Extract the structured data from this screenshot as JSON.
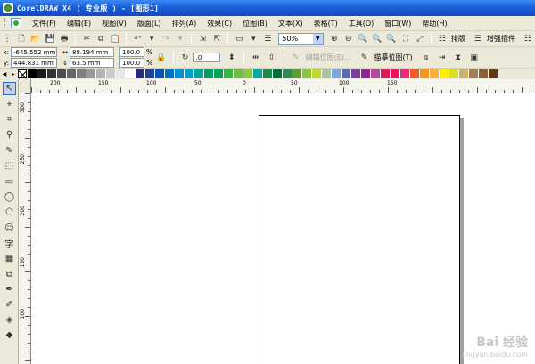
{
  "window": {
    "title": "CorelDRAW X4 ( 专业版 ) - [图形1]"
  },
  "menu": {
    "items": [
      "文件(F)",
      "编辑(E)",
      "视图(V)",
      "版面(L)",
      "排列(A)",
      "效果(C)",
      "位图(B)",
      "文本(X)",
      "表格(T)",
      "工具(O)",
      "窗口(W)",
      "帮助(H)"
    ]
  },
  "toolbar": {
    "zoom_value": "50%",
    "layout_label": "排版",
    "enhance_label": "增强插件"
  },
  "property_bar": {
    "x_label": "x:",
    "x_value": "-645.552 mm",
    "y_label": "y:",
    "y_value": "444.831 mm",
    "w_value": "88.194 mm",
    "h_value": "63.5 mm",
    "scale_x": "100.0",
    "scale_y": "100.0",
    "percent": "%",
    "angle": ".0",
    "edit_bitmap_label": "编辑位图(E)...",
    "trace_bitmap_label": "描摹位图(T)"
  },
  "palette": {
    "colors": [
      "#000000",
      "#1a1a1a",
      "#333333",
      "#4d4d4d",
      "#666666",
      "#808080",
      "#999999",
      "#b3b3b3",
      "#cccccc",
      "#e6e6e6",
      "#ffffff",
      "#2b2d7a",
      "#1f3f99",
      "#0057b8",
      "#0070c0",
      "#0091d2",
      "#00a3c4",
      "#00a89d",
      "#009a66",
      "#00a651",
      "#39b54a",
      "#6dbe45",
      "#8dc63f",
      "#00a99d",
      "#1c8b4a",
      "#00703c",
      "#2e8b57",
      "#5c9e31",
      "#8cc63f",
      "#bfd730",
      "#a8c5a0",
      "#7da7d9",
      "#5b6bb2",
      "#7b3f98",
      "#92278f",
      "#b14a9b",
      "#d91c5c",
      "#ed145b",
      "#ee2a7b",
      "#f15a24",
      "#f7941d",
      "#fbb040",
      "#fff200",
      "#d7df23",
      "#c8b273",
      "#a67c52",
      "#8b5e3c",
      "#603913"
    ]
  },
  "ruler": {
    "h_labels": [
      "200",
      "150",
      "100",
      "50",
      "0",
      "50",
      "100",
      "150"
    ],
    "v_labels": [
      "300",
      "250",
      "200",
      "150",
      "100"
    ]
  },
  "watermark": {
    "text": "Bai 经验",
    "sub": "jingyan.baidu.com"
  }
}
